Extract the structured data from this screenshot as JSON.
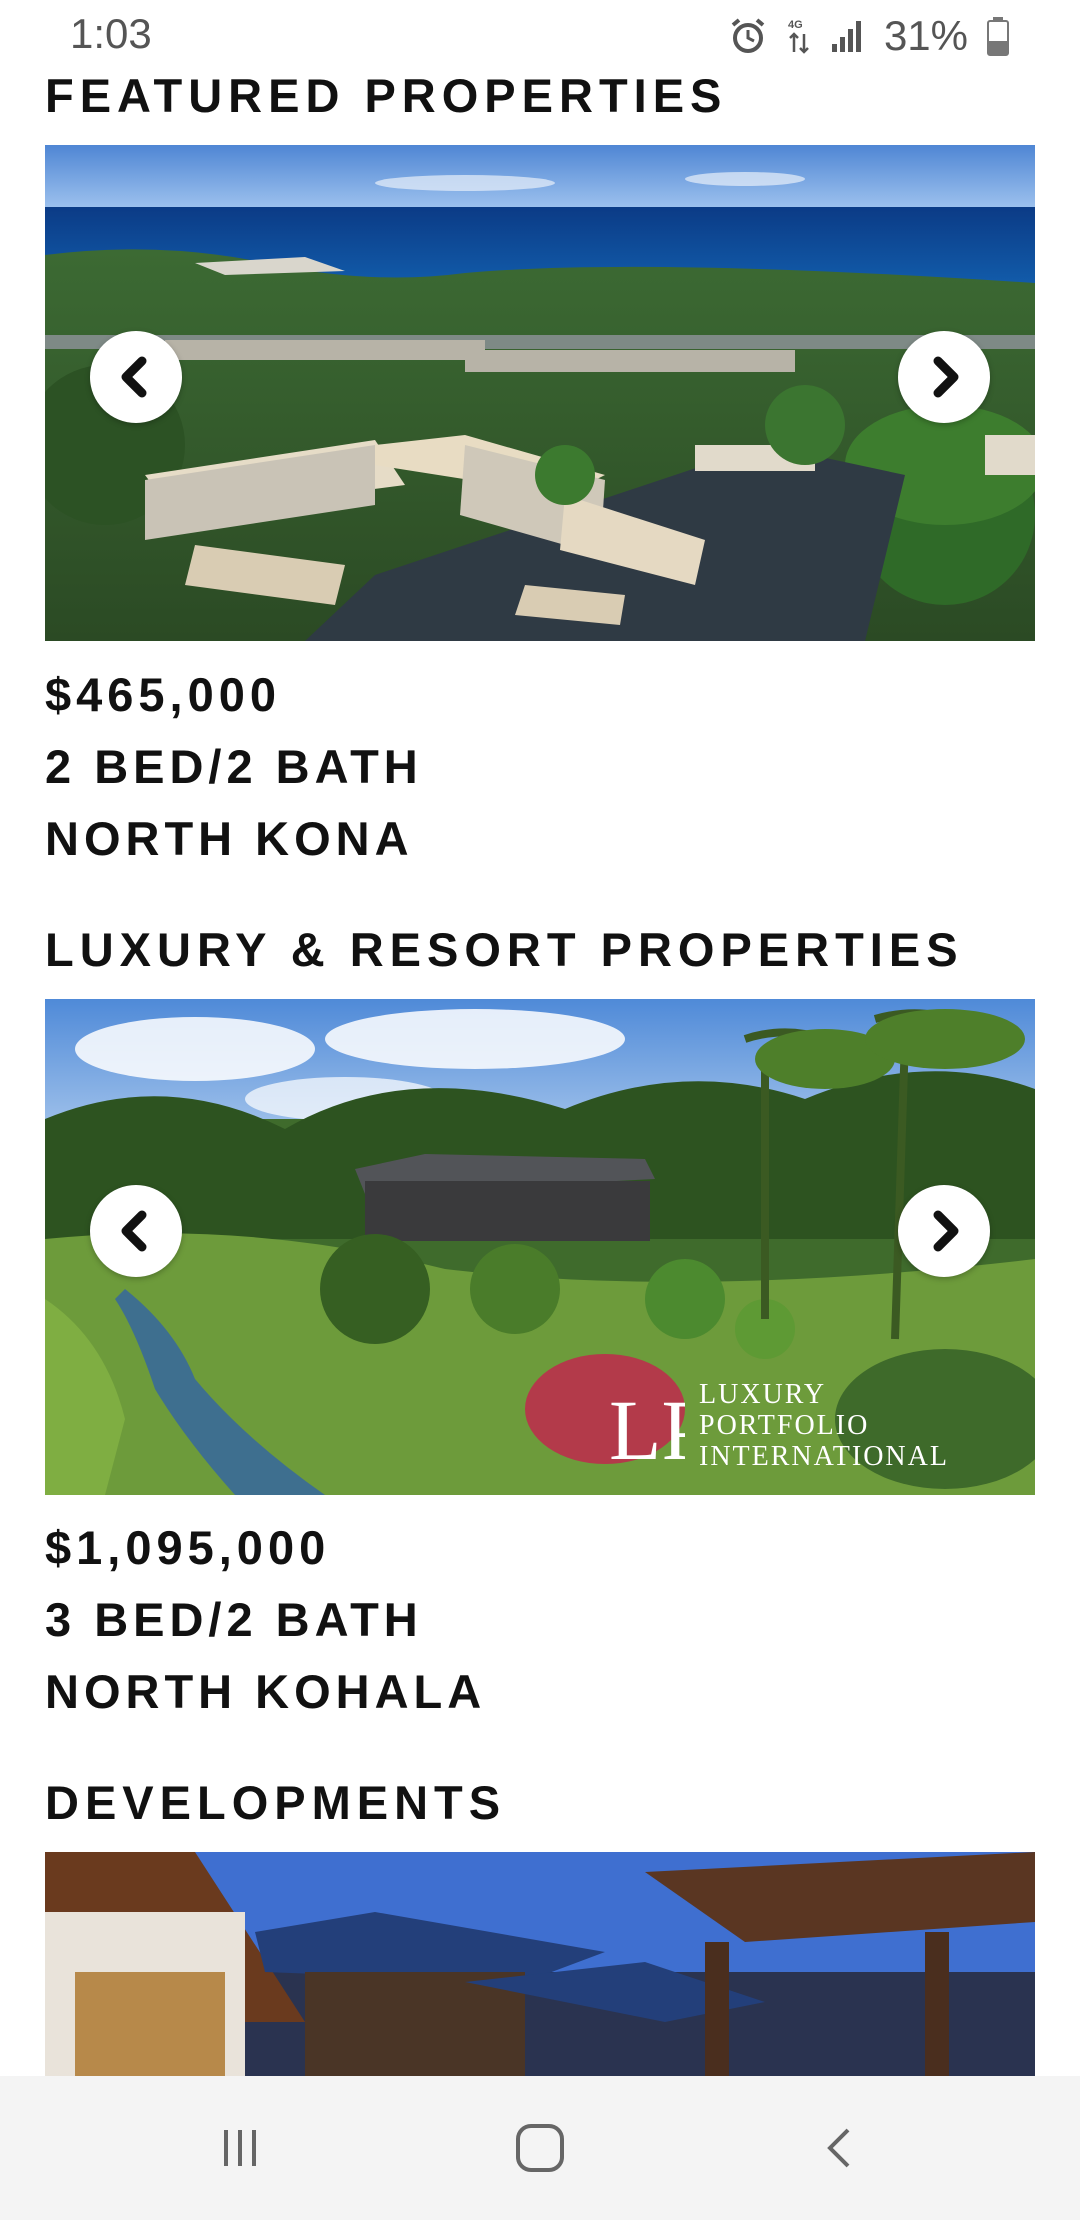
{
  "status_bar": {
    "time": "1:03",
    "battery": "31%",
    "icons": [
      "alarm-icon",
      "lte-data-icon",
      "signal-icon",
      "battery-icon"
    ]
  },
  "sections": [
    {
      "title": "FEATURED PROPERTIES",
      "price": "$465,000",
      "beds_baths": "2 BED/2 BATH",
      "location": "NORTH KONA"
    },
    {
      "title": "LUXURY & RESORT PROPERTIES",
      "price": "$1,095,000",
      "beds_baths": "3 BED/2 BATH",
      "location": "NORTH KOHALA",
      "watermark": {
        "monogram": "LP",
        "line1": "LUXURY",
        "line2": "PORTFOLIO",
        "line3": "INTERNATIONAL"
      }
    },
    {
      "title": "DEVELOPMENTS"
    }
  ],
  "carousel_icons": {
    "prev": "chevron-left-icon",
    "next": "chevron-right-icon"
  },
  "nav_bar": {
    "icons": [
      "recent-apps-icon",
      "home-icon",
      "back-icon"
    ]
  },
  "colors": {
    "text": "#111111",
    "ocean": "#0a3f8c",
    "sky": "#5a8fd6",
    "nav_bg": "#f4f4f4"
  }
}
